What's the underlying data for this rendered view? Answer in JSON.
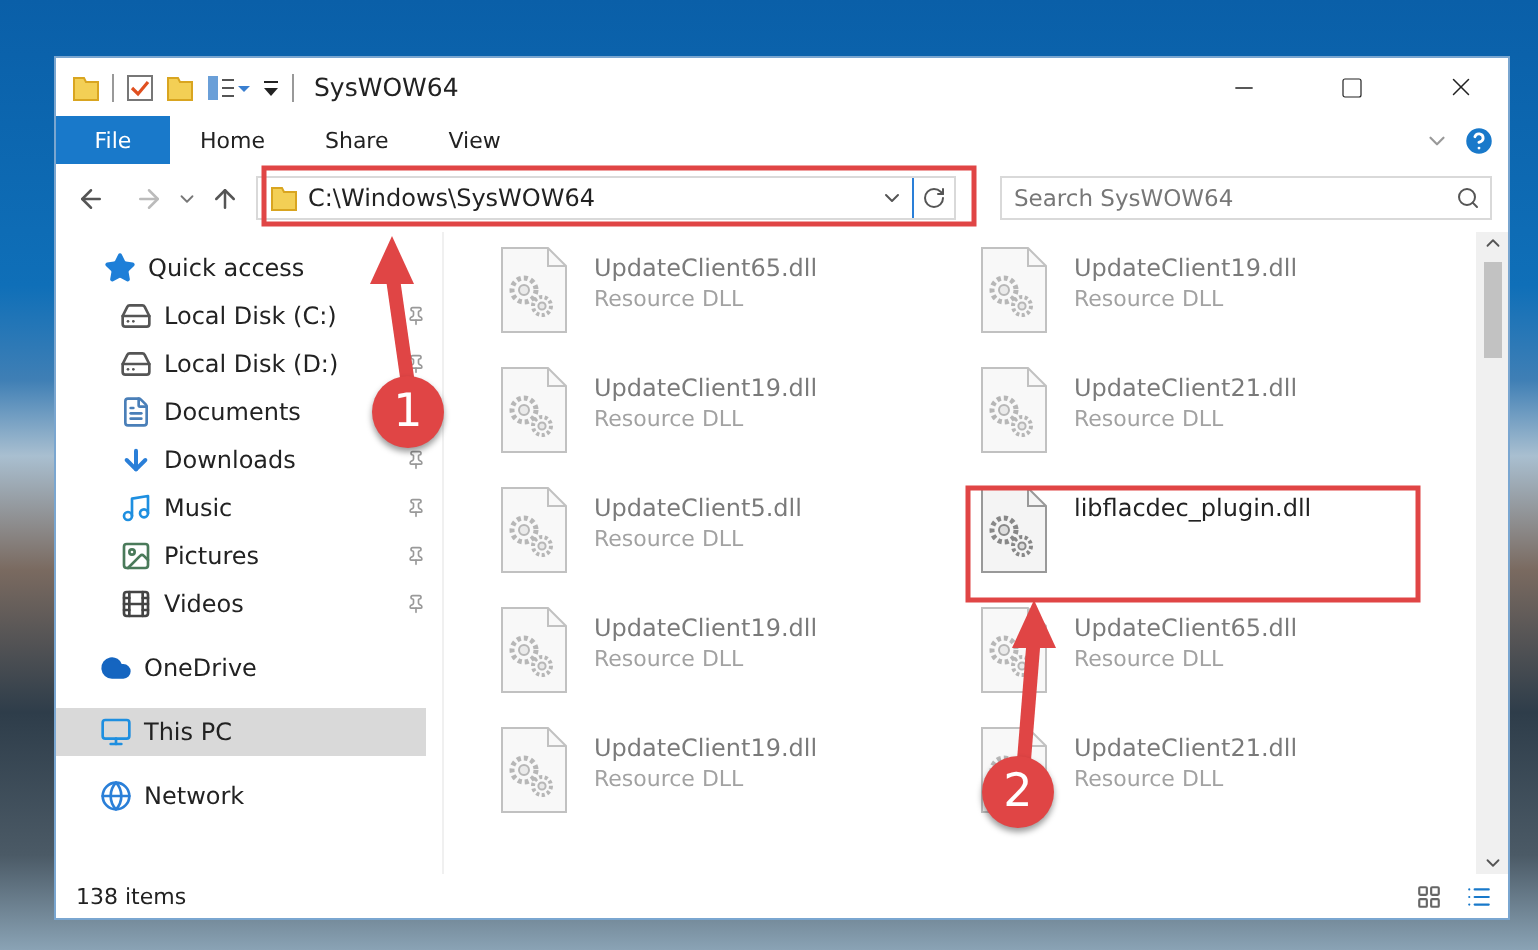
{
  "window": {
    "title": "SysWOW64"
  },
  "ribbon": {
    "tabs": [
      {
        "label": "File",
        "selected": true
      },
      {
        "label": "Home",
        "selected": false
      },
      {
        "label": "Share",
        "selected": false
      },
      {
        "label": "View",
        "selected": false
      }
    ]
  },
  "address_bar": {
    "path": "C:\\Windows\\SysWOW64"
  },
  "search": {
    "placeholder": "Search SysWOW64"
  },
  "navigation": [
    {
      "label": "Quick access",
      "kind": "star",
      "selected": false,
      "children": [
        {
          "label": "Local Disk (C:)",
          "kind": "disk",
          "pinned": true,
          "selected": false
        },
        {
          "label": "Local Disk (D:)",
          "kind": "disk",
          "pinned": true,
          "selected": false
        },
        {
          "label": "Documents",
          "kind": "doc",
          "selected": false
        },
        {
          "label": "Downloads",
          "kind": "download",
          "pinned": true,
          "selected": false
        },
        {
          "label": "Music",
          "kind": "music",
          "pinned": true,
          "selected": false
        },
        {
          "label": "Pictures",
          "kind": "pictures",
          "pinned": true,
          "selected": false
        },
        {
          "label": "Videos",
          "kind": "videos",
          "pinned": true,
          "selected": false
        }
      ]
    },
    {
      "label": "OneDrive",
      "kind": "cloud",
      "selected": false
    },
    {
      "label": "This PC",
      "kind": "pc",
      "selected": true
    },
    {
      "label": "Network",
      "kind": "network",
      "selected": false
    }
  ],
  "files": [
    {
      "name": "UpdateClient65.dll",
      "type": "Resource DLL",
      "blurred": true
    },
    {
      "name": "UpdateClient19.dll",
      "type": "Resource DLL",
      "blurred": true
    },
    {
      "name": "UpdateClient19.dll",
      "type": "Resource DLL",
      "blurred": true
    },
    {
      "name": "UpdateClient21.dll",
      "type": "Resource DLL",
      "blurred": true
    },
    {
      "name": "UpdateClient5.dll",
      "type": "Resource DLL",
      "blurred": true
    },
    {
      "name": "libflacdec_plugin.dll",
      "blurred": false
    },
    {
      "name": "UpdateClient19.dll",
      "type": "Resource DLL",
      "blurred": true
    },
    {
      "name": "UpdateClient65.dll",
      "type": "Resource DLL",
      "blurred": true
    },
    {
      "name": "UpdateClient19.dll",
      "type": "Resource DLL",
      "blurred": true
    },
    {
      "name": "UpdateClient21.dll",
      "type": "Resource DLL",
      "blurred": true
    }
  ],
  "status_bar": {
    "item_count": "138 items"
  },
  "annotations": [
    {
      "number": "1"
    },
    {
      "number": "2"
    }
  ]
}
